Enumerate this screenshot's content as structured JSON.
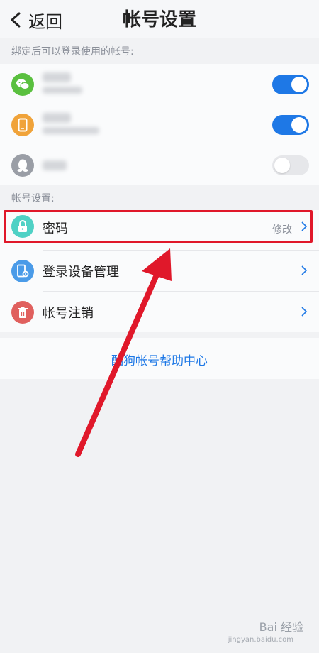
{
  "header": {
    "back_label": "返回",
    "title": "帐号设置"
  },
  "bound_section": {
    "label": "绑定后可以登录使用的帐号:",
    "accounts": [
      {
        "icon": "wechat-icon",
        "color": "#5ac03f",
        "enabled": true
      },
      {
        "icon": "phone-icon",
        "color": "#f0a33a",
        "enabled": true
      },
      {
        "icon": "qq-icon",
        "color": "#9a9ea6",
        "enabled": false
      }
    ]
  },
  "settings_section": {
    "label": "帐号设置:",
    "items": [
      {
        "label": "密码",
        "value": "修改",
        "icon": "lock-icon",
        "color": "#4fd1c5"
      },
      {
        "label": "登录设备管理",
        "value": "",
        "icon": "device-gear-icon",
        "color": "#4a9be8"
      },
      {
        "label": "帐号注销",
        "value": "",
        "icon": "trash-icon",
        "color": "#e0605e"
      }
    ]
  },
  "help": {
    "link_text": "酷狗帐号帮助中心"
  },
  "watermark": {
    "text": "Bai 经验",
    "sub": "jingyan.baidu.com"
  },
  "colors": {
    "accent": "#1e78e6",
    "annotation_red": "#e0182a"
  }
}
